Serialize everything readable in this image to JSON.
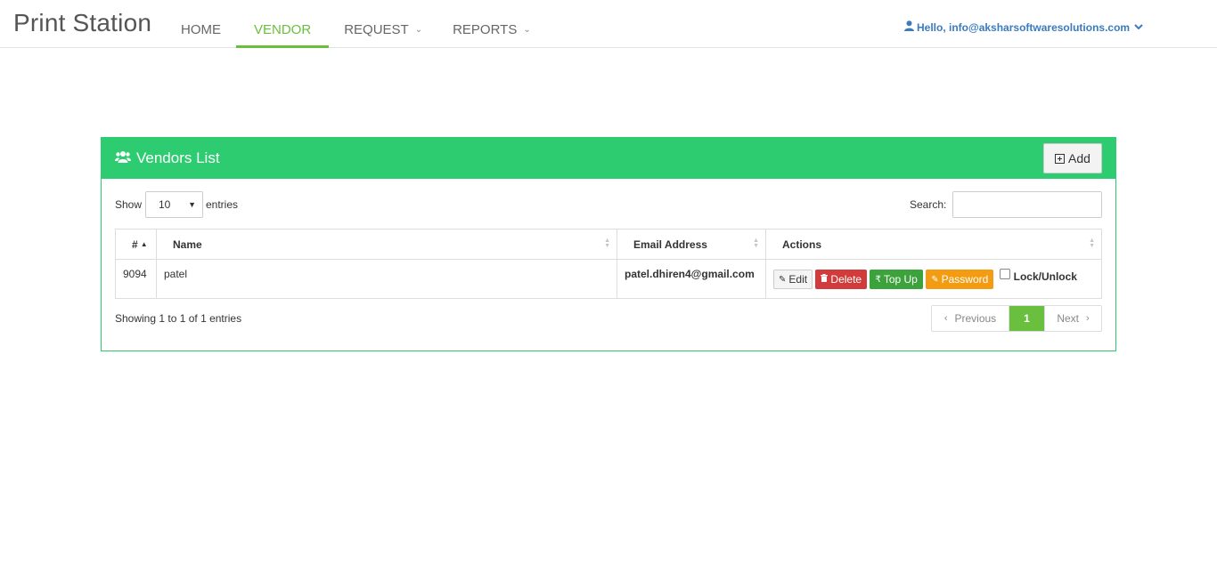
{
  "app": {
    "brand": "Print Station"
  },
  "nav": {
    "items": [
      {
        "label": "HOME"
      },
      {
        "label": "VENDOR"
      },
      {
        "label": "REQUEST"
      },
      {
        "label": "REPORTS"
      }
    ]
  },
  "user": {
    "greeting": "Hello, info@aksharsoftwaresolutions.com"
  },
  "panel": {
    "title": "Vendors List",
    "add_label": "Add"
  },
  "controls": {
    "show_label": "Show",
    "page_length": "10",
    "entries_label": "entries",
    "search_label": "Search:",
    "search_value": ""
  },
  "table": {
    "headers": [
      "#",
      "Name",
      "Email Address",
      "Actions"
    ],
    "rows": [
      {
        "id": "9094",
        "name": "patel",
        "email": "patel.dhiren4@gmail.com"
      }
    ],
    "actions": {
      "edit": "Edit",
      "delete": "Delete",
      "topup": "Top Up",
      "password": "Password",
      "lock": "Lock/Unlock"
    }
  },
  "footer": {
    "info": "Showing 1 to 1 of 1 entries",
    "prev": "Previous",
    "current": "1",
    "next": "Next"
  },
  "colors": {
    "accent": "#2ecc71",
    "nav_active": "#6bbf3e",
    "delete": "#d23b3b",
    "topup": "#3ca23c",
    "password": "#f39c12",
    "link": "#3a7bbf"
  }
}
